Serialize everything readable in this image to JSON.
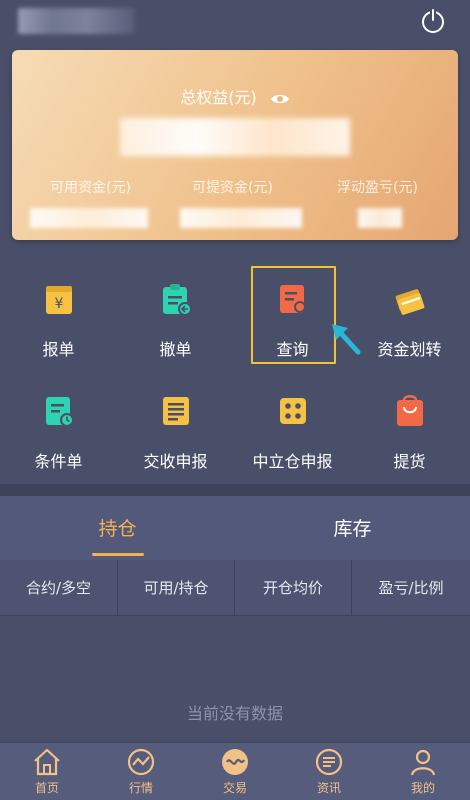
{
  "header": {
    "power_icon": "power-icon"
  },
  "account_card": {
    "title": "总权益(元)",
    "eye_icon": "eye-icon",
    "stats": [
      {
        "label": "可用资金(元)"
      },
      {
        "label": "可提资金(元)"
      },
      {
        "label": "浮动盈亏(元)"
      }
    ]
  },
  "actions": [
    {
      "label": "报单",
      "icon": "order-icon",
      "color": "#f6c244"
    },
    {
      "label": "撤单",
      "icon": "cancel-order-icon",
      "color": "#2ed3b0"
    },
    {
      "label": "查询",
      "icon": "query-icon",
      "color": "#f26a45"
    },
    {
      "label": "资金划转",
      "icon": "fund-transfer-icon",
      "color": "#f6c244"
    },
    {
      "label": "条件单",
      "icon": "conditional-order-icon",
      "color": "#2ed3b0"
    },
    {
      "label": "交收申报",
      "icon": "delivery-declaration-icon",
      "color": "#f6c244"
    },
    {
      "label": "中立仓申报",
      "icon": "neutral-position-icon",
      "color": "#f6c244"
    },
    {
      "label": "提货",
      "icon": "pickup-icon",
      "color": "#f26a45"
    }
  ],
  "tabs": [
    {
      "label": "持仓"
    },
    {
      "label": "库存"
    }
  ],
  "columns": [
    {
      "label": "合约/多空"
    },
    {
      "label": "可用/持仓"
    },
    {
      "label": "开仓均价"
    },
    {
      "label": "盈亏/比例"
    }
  ],
  "empty_message": "当前没有数据",
  "bottom_nav": [
    {
      "label": "首页",
      "icon": "home-icon"
    },
    {
      "label": "行情",
      "icon": "market-icon"
    },
    {
      "label": "交易",
      "icon": "trade-icon"
    },
    {
      "label": "资讯",
      "icon": "news-icon"
    },
    {
      "label": "我的",
      "icon": "profile-icon"
    }
  ],
  "colors": {
    "accent": "#f4b24e",
    "highlight": "#f1c232",
    "arrow": "#29b6d8",
    "background": "#4a4f69"
  }
}
